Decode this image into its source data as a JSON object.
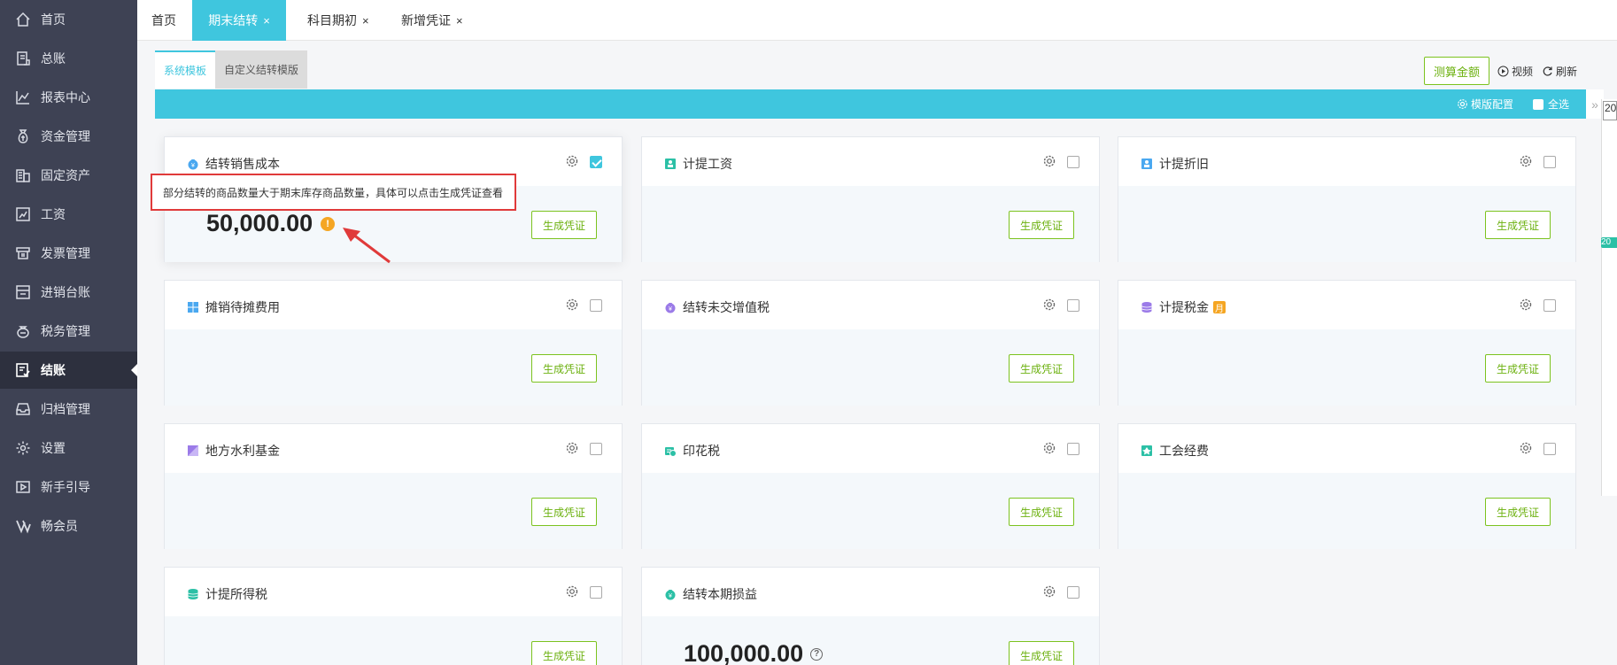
{
  "sidebar": {
    "items": [
      {
        "label": "首页",
        "icon": "home-icon"
      },
      {
        "label": "总账",
        "icon": "ledger-icon"
      },
      {
        "label": "报表中心",
        "icon": "chart-icon"
      },
      {
        "label": "资金管理",
        "icon": "money-bag-icon"
      },
      {
        "label": "固定资产",
        "icon": "building-icon"
      },
      {
        "label": "工资",
        "icon": "salary-icon"
      },
      {
        "label": "发票管理",
        "icon": "invoice-icon"
      },
      {
        "label": "进销台账",
        "icon": "inventory-icon"
      },
      {
        "label": "税务管理",
        "icon": "tax-icon"
      },
      {
        "label": "结账",
        "icon": "checkout-icon",
        "active": true
      },
      {
        "label": "归档管理",
        "icon": "archive-icon"
      },
      {
        "label": "设置",
        "icon": "gear-icon"
      },
      {
        "label": "新手引导",
        "icon": "guide-icon"
      },
      {
        "label": "畅会员",
        "icon": "vip-icon"
      }
    ]
  },
  "tabs": [
    {
      "label": "首页",
      "closable": false,
      "active": false
    },
    {
      "label": "期末结转",
      "closable": true,
      "active": true
    },
    {
      "label": "科目期初",
      "closable": true,
      "active": false
    },
    {
      "label": "新增凭证",
      "closable": true,
      "active": false
    }
  ],
  "close_glyph": "×",
  "subtabs": [
    {
      "label": "系统模板",
      "active": true
    },
    {
      "label": "自定义结转模版",
      "active": false
    }
  ],
  "toolbar": {
    "calc_label": "测算金额",
    "video_label": "视频",
    "refresh_label": "刷新",
    "template_config_label": "模版配置",
    "select_all_label": "全选",
    "expand_glyph": "»"
  },
  "side_panel": {
    "input_value": "20",
    "badge_text": "20"
  },
  "cards": [
    {
      "title": "结转销售成本",
      "icon": "cost-icon",
      "checked": true,
      "amount": "50,000.00",
      "amount_icon": "warning-icon",
      "button": "生成凭证"
    },
    {
      "title": "计提工资",
      "icon": "salary-card-icon",
      "checked": false,
      "button": "生成凭证"
    },
    {
      "title": "计提折旧",
      "icon": "depreciation-icon",
      "checked": false,
      "button": "生成凭证"
    },
    {
      "title": "摊销待摊费用",
      "icon": "windows-grid-icon",
      "checked": false,
      "button": "生成凭证"
    },
    {
      "title": "结转未交增值税",
      "icon": "vat-icon",
      "checked": false,
      "button": "生成凭证"
    },
    {
      "title": "计提税金",
      "icon": "coins-stack-icon",
      "checked": false,
      "tag": "月",
      "button": "生成凭证"
    },
    {
      "title": "地方水利基金",
      "icon": "water-fund-icon",
      "checked": false,
      "button": "生成凭证"
    },
    {
      "title": "印花税",
      "icon": "stamp-tax-icon",
      "checked": false,
      "button": "生成凭证"
    },
    {
      "title": "工会经费",
      "icon": "union-fund-icon",
      "checked": false,
      "button": "生成凭证"
    },
    {
      "title": "计提所得税",
      "icon": "income-tax-icon",
      "checked": false,
      "button": "生成凭证"
    },
    {
      "title": "结转本期损益",
      "icon": "profit-loss-icon",
      "checked": false,
      "amount": "100,000.00",
      "amount_icon": "help-icon",
      "button": "生成凭证"
    }
  ],
  "tooltip": {
    "text": "部分结转的商品数量大于期末库存商品数量，具体可以点击生成凭证查看"
  },
  "colors": {
    "sidebar_bg": "#3e4254",
    "accent_cyan": "#3fc6de",
    "button_green": "#7cc31f",
    "warning_orange": "#f5a623",
    "tooltip_border": "#e03a3a"
  }
}
